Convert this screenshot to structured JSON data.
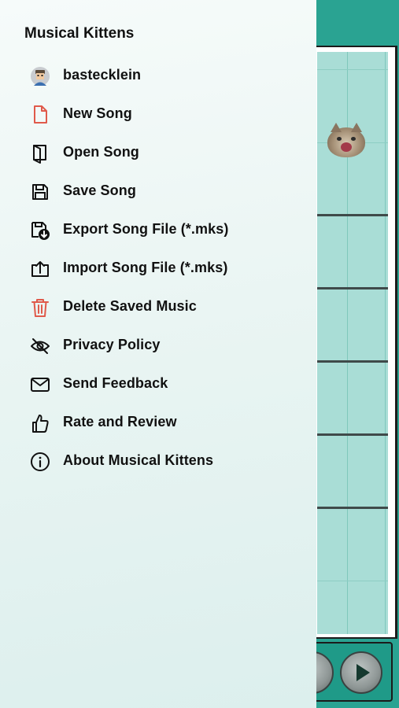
{
  "app": {
    "title": "Musical Kittens"
  },
  "colors": {
    "accent_red": "#e05a4b",
    "teal": "#2aa392",
    "text": "#111111"
  },
  "menu": {
    "items": [
      {
        "label": "bastecklein",
        "icon": "avatar-icon"
      },
      {
        "label": "New Song",
        "icon": "new-file-icon"
      },
      {
        "label": "Open Song",
        "icon": "open-file-icon"
      },
      {
        "label": "Save Song",
        "icon": "floppy-disk-icon"
      },
      {
        "label": "Export Song File (*.mks)",
        "icon": "export-icon"
      },
      {
        "label": "Import Song File (*.mks)",
        "icon": "import-icon"
      },
      {
        "label": "Delete Saved Music",
        "icon": "trash-icon"
      },
      {
        "label": "Privacy Policy",
        "icon": "eye-slash-icon"
      },
      {
        "label": "Send Feedback",
        "icon": "envelope-icon"
      },
      {
        "label": "Rate and Review",
        "icon": "thumbs-up-icon"
      },
      {
        "label": "About Musical Kittens",
        "icon": "info-icon"
      }
    ]
  }
}
